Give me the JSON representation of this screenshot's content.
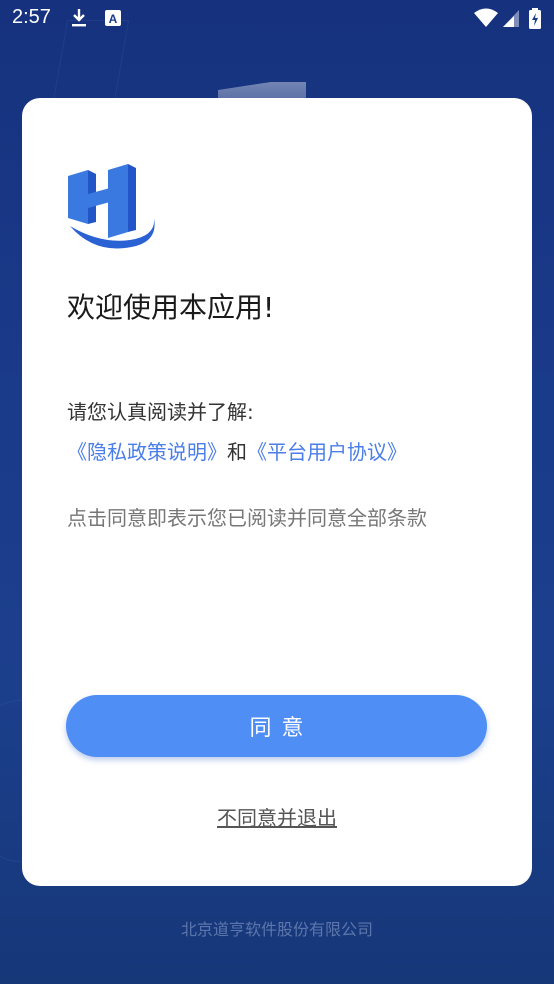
{
  "status_bar": {
    "time": "2:57",
    "left_icons": [
      "download-icon",
      "keyboard-a-icon"
    ],
    "right_icons": [
      "wifi-icon",
      "signal-icon",
      "battery-icon"
    ]
  },
  "dialog": {
    "logo_icon": "h-logo-icon",
    "logo_colors": [
      "#3a7ae0",
      "#2255c8"
    ],
    "welcome": "欢迎使用本应用!",
    "intro": "请您认真阅读并了解:",
    "privacy_link": "《隐私政策说明》",
    "and_text": "和",
    "agreement_link": "《平台用户协议》",
    "note": "点击同意即表示您已阅读并同意全部条款",
    "agree_label": "同意",
    "decline_label": "不同意并退出"
  },
  "footer": {
    "company": "北京道亨软件股份有限公司"
  },
  "colors": {
    "accent": "#4f8ef5",
    "link": "#4a7ee8",
    "background": "#1a3a8a"
  }
}
